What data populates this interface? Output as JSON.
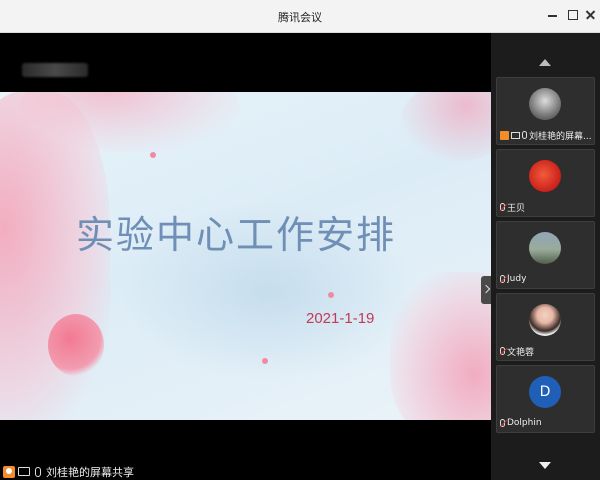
{
  "window": {
    "title": "腾讯会议"
  },
  "slide": {
    "title": "实验中心工作安排",
    "date": "2021-1-19"
  },
  "presenter_bar": {
    "label": "刘桂艳的屏幕共享"
  },
  "participants": [
    {
      "name": "刘桂艳的屏幕...",
      "avatar_initial": "",
      "sharing": true
    },
    {
      "name": "王贝",
      "avatar_initial": "",
      "sharing": false
    },
    {
      "name": "Judy",
      "avatar_initial": "",
      "sharing": false
    },
    {
      "name": "文艳蓉",
      "avatar_initial": "",
      "sharing": false
    },
    {
      "name": "Dolphin",
      "avatar_initial": "D",
      "sharing": false
    }
  ],
  "colors": {
    "accent_orange": "#f28c2a",
    "slide_title": "#6f8fb6",
    "slide_date": "#c23a55"
  }
}
